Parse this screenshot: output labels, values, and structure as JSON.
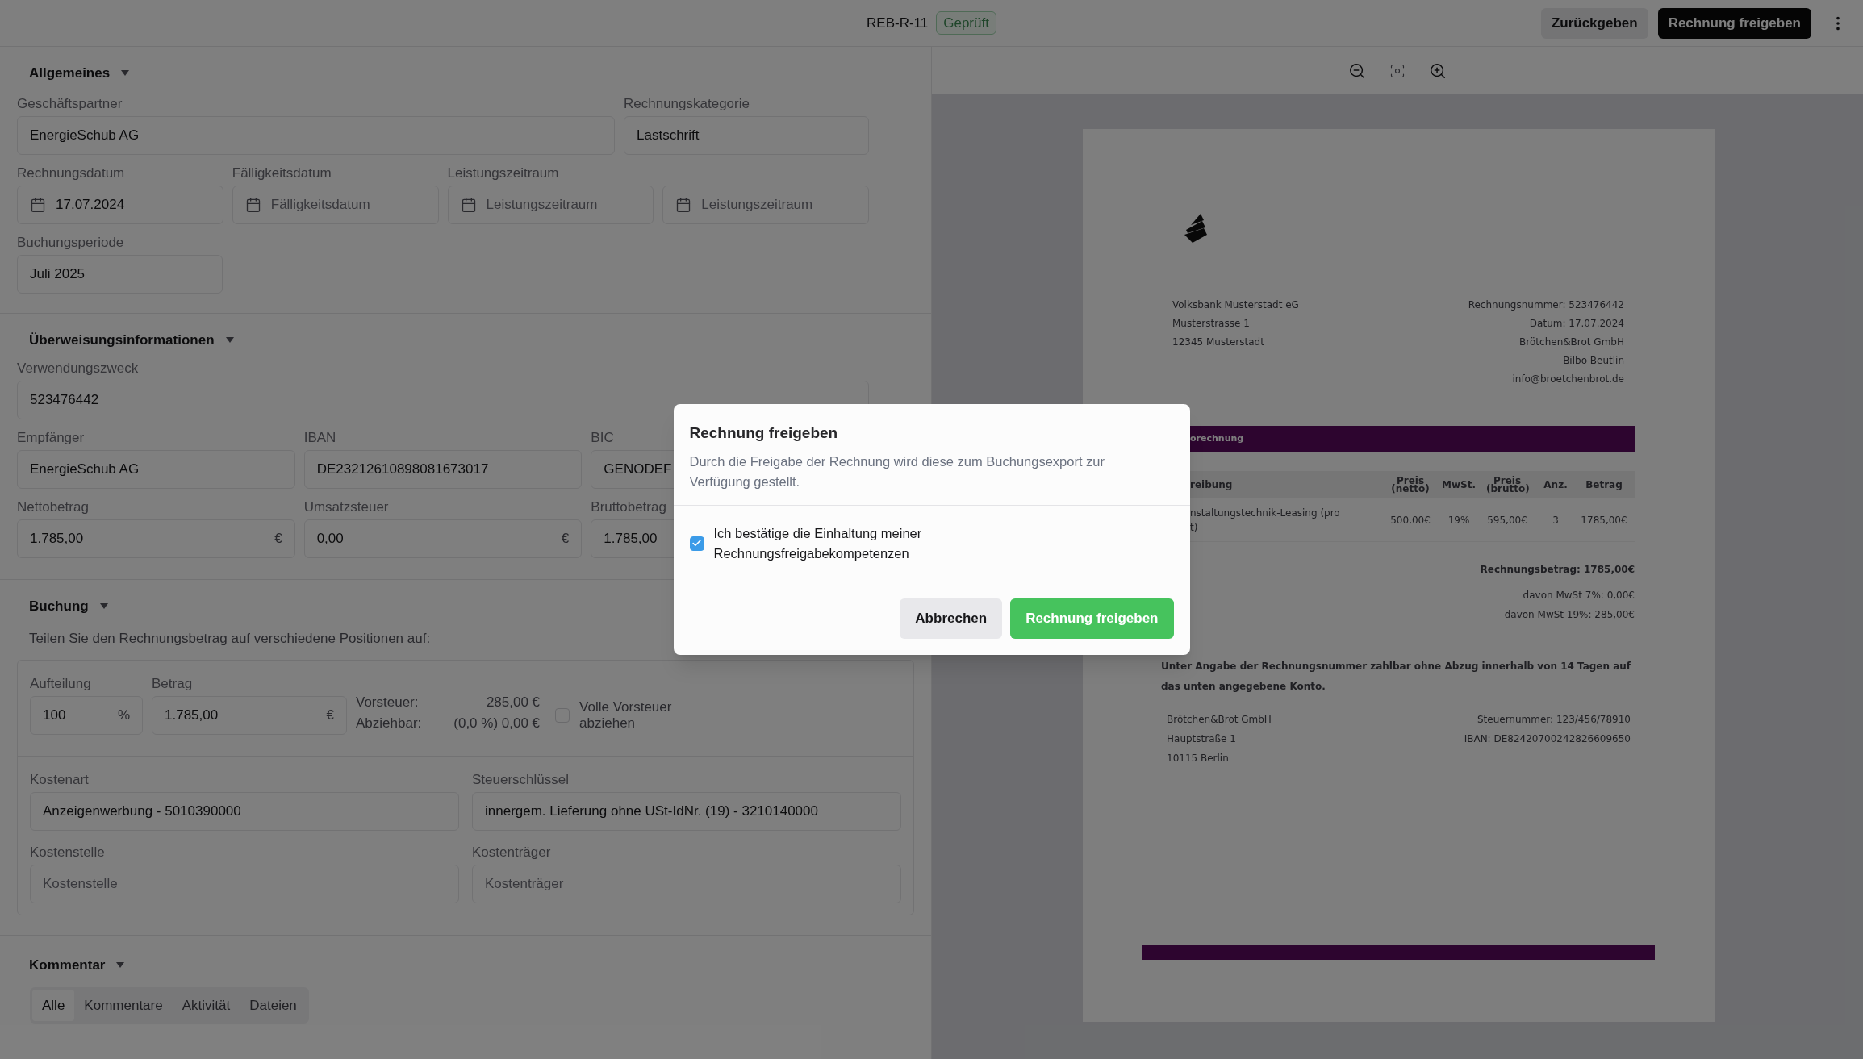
{
  "header": {
    "invoice_id": "REB-R-11",
    "status_badge": "Geprüft",
    "buttons": [
      {
        "label": "Zurückgeben",
        "kind": "secondary"
      },
      {
        "label": "Rechnung freigeben",
        "kind": "primary"
      }
    ]
  },
  "general": {
    "title": "Allgemeines",
    "partner": {
      "label": "Geschäftspartner",
      "value": "EnergieSchub AG"
    },
    "category": {
      "label": "Rechnungskategorie",
      "value": "Lastschrift"
    },
    "dates": [
      {
        "label": "Rechnungsdatum",
        "value": "17.07.2024"
      },
      {
        "label": "Fälligkeitsdatum",
        "placeholder": "Fälligkeitsdatum"
      },
      {
        "label": "Leistungszeitraum",
        "placeholder": "Leistungszeitraum"
      },
      {
        "placeholder": "Leistungszeitraum"
      }
    ],
    "period": {
      "label": "Buchungsperiode",
      "value": "Juli 2025"
    }
  },
  "transfer": {
    "title": "Überweisungsinformationen",
    "purpose": {
      "label": "Verwendungszweck",
      "value": "523476442"
    },
    "row1": [
      {
        "label": "Empfänger",
        "value": "EnergieSchub AG"
      },
      {
        "label": "IBAN",
        "value": "DE23212610898081673017"
      },
      {
        "label": "BIC",
        "value": "GENODEF"
      }
    ],
    "row2": [
      {
        "label": "Nettobetrag",
        "value": "1.785,00",
        "suffix": "€"
      },
      {
        "label": "Umsatzsteuer",
        "value": "0,00",
        "suffix": "€"
      },
      {
        "label": "Bruttobetrag",
        "value": "1.785,00"
      }
    ]
  },
  "booking": {
    "title": "Buchung",
    "hint": "Teilen Sie den Rechnungsbetrag auf verschiedene Positionen auf:",
    "split": {
      "label": "Aufteilung",
      "value": "100",
      "suffix": "%"
    },
    "amount": {
      "label": "Betrag",
      "value": "1.785,00",
      "suffix": "€"
    },
    "tax_lines": [
      {
        "label": "Vorsteuer:",
        "value": "285,00 €"
      },
      {
        "label": "Abziehbar:",
        "value": "(0,0 %) 0,00 €"
      }
    ],
    "full_tax": {
      "label": "Volle Vorsteuer abziehen",
      "checked": false
    },
    "cost_type": {
      "label": "Kostenart",
      "value": "Anzeigenwerbung - 5010390000"
    },
    "tax_key": {
      "label": "Steuerschlüssel",
      "value": "innergem. Lieferung ohne USt-IdNr. (19) - 3210140000"
    },
    "cost_center": {
      "label": "Kostenstelle",
      "placeholder": "Kostenstelle"
    },
    "cost_unit": {
      "label": "Kostenträger",
      "placeholder": "Kostenträger"
    }
  },
  "comment": {
    "title": "Kommentar",
    "tabs": [
      {
        "label": "Alle",
        "selected": true
      },
      {
        "label": "Kommentare",
        "selected": false
      },
      {
        "label": "Aktivität",
        "selected": false
      },
      {
        "label": "Dateien",
        "selected": false
      }
    ]
  },
  "document": {
    "sender_lines": [
      "Volksbank Musterstadt eG",
      "Musterstrasse 1",
      "12345 Musterstadt"
    ],
    "meta_lines": [
      "Rechnungsnummer: 523476442",
      "Datum: 17.07.2024",
      "Brötchen&Brot GmbH",
      "Bilbo Beutlin",
      "info@broetchenbrot.de"
    ],
    "section_bar": "orechnung",
    "columns": [
      "reibung",
      "Preis (netto)",
      "MwSt.",
      "Preis (brutto)",
      "Anz.",
      "Betrag"
    ],
    "row": {
      "description_lines": [
        "nstaltungstechnik-Leasing (pro",
        "t)"
      ],
      "cells": [
        "500,00€",
        "19%",
        "595,00€",
        "3",
        "1785,00€"
      ]
    },
    "total": "Rechnungsbetrag: 1785,00€",
    "vat_lines": [
      "davon MwSt 7%: 0,00€",
      "davon MwSt 19%: 285,00€"
    ],
    "payment_note": "Unter Angabe der Rechnungsnummer zahlbar ohne Abzug innerhalb von 14 Tagen auf das unten angegebene Konto.",
    "footer_left": [
      "Brötchen&Brot GmbH",
      "Hauptstraße 1",
      "10115 Berlin"
    ],
    "footer_right": [
      "Steuernummer: 123/456/78910",
      "IBAN: DE82420700242826609650"
    ]
  },
  "modal": {
    "title": "Rechnung freigeben",
    "description": "Durch die Freigabe der Rechnung wird diese zum Buchungsexport zur Verfügung gestellt.",
    "confirm": {
      "label": "Ich bestätige die Einhaltung meiner Rechnungsfreigabekompetenzen",
      "checked": true
    },
    "buttons": [
      {
        "label": "Abbrechen",
        "kind": "secondary"
      },
      {
        "label": "Rechnung freigeben",
        "kind": "success"
      }
    ]
  }
}
